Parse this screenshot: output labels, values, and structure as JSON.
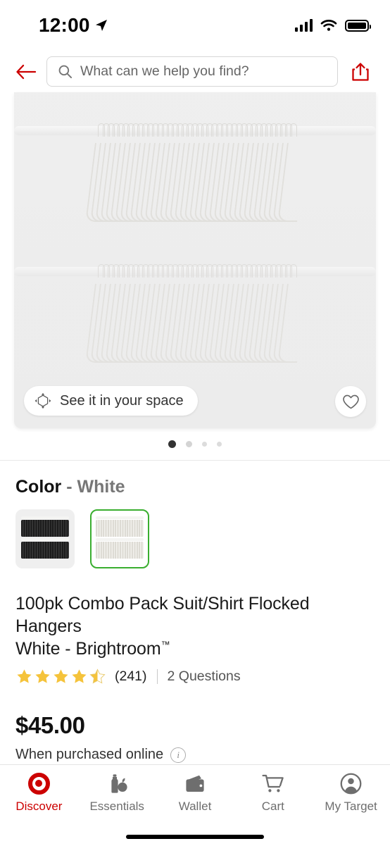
{
  "status_bar": {
    "time": "12:00",
    "location_icon": "location-arrow-icon",
    "signal_icon": "cellular-signal-icon",
    "wifi_icon": "wifi-icon",
    "battery_icon": "battery-full-icon"
  },
  "header": {
    "back_icon": "back-arrow-icon",
    "search_icon": "search-icon",
    "search_value": "",
    "search_placeholder": "What can we help you find?",
    "share_icon": "share-icon",
    "accent_color": "#cc0000"
  },
  "gallery": {
    "ar_button_label": "See it in your space",
    "ar_icon": "ar-cube-icon",
    "favorite_icon": "heart-outline-icon",
    "dot_count": 4,
    "active_dot": 0,
    "image_alt": "White flocked suit and shirt hangers on two closet rods"
  },
  "color_section": {
    "label": "Color",
    "separator": "-",
    "value": "White",
    "selected_index": 1,
    "selected_border_color": "#3aae2f",
    "swatches": [
      {
        "name": "Black",
        "tone": "dark",
        "selected": false
      },
      {
        "name": "White",
        "tone": "light",
        "selected": true
      }
    ]
  },
  "product": {
    "title_line1": "100pk Combo Pack Suit/Shirt Flocked Hangers",
    "title_line2": "White - Brightroom",
    "trademark": "™",
    "rating": 4.5,
    "star_count": 5,
    "review_count": "(241)",
    "questions": "2 Questions",
    "star_color": "#f5c33b"
  },
  "pricing": {
    "price": "$45.00",
    "note": "When purchased online",
    "info_icon": "info-circle-icon",
    "info_glyph": "i"
  },
  "tabbar": {
    "items": [
      {
        "label": "Discover",
        "icon": "target-bullseye-icon",
        "active": true
      },
      {
        "label": "Essentials",
        "icon": "groceries-icon",
        "active": false
      },
      {
        "label": "Wallet",
        "icon": "wallet-icon",
        "active": false
      },
      {
        "label": "Cart",
        "icon": "shopping-cart-icon",
        "active": false
      },
      {
        "label": "My Target",
        "icon": "account-circle-icon",
        "active": false
      }
    ],
    "active_color": "#cc0000",
    "inactive_color": "#6e6e6e"
  }
}
